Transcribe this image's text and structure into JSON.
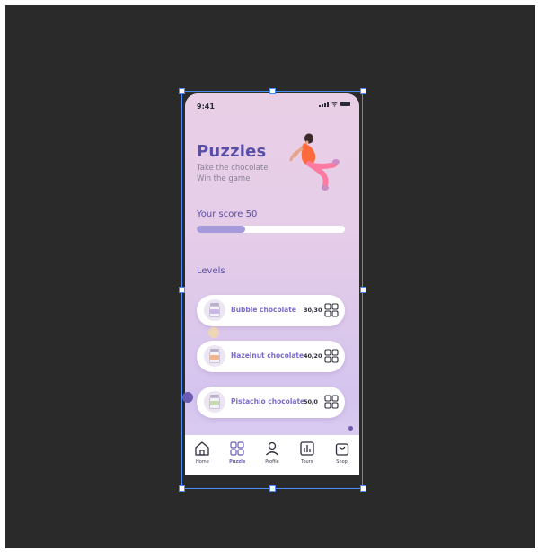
{
  "status_bar": {
    "time": "9:41"
  },
  "header": {
    "title": "Puzzles",
    "subtitle_line1": "Take the chocolate",
    "subtitle_line2": "Win the game"
  },
  "score": {
    "label": "Your score 50",
    "progress": 0.33
  },
  "levels": {
    "heading": "Levels",
    "items": [
      {
        "name": "Bubble chocolate",
        "score": "30/30",
        "jar_color": "#c9b8e8"
      },
      {
        "name": "Hazelnut chocolate",
        "score": "40/20",
        "jar_color": "#f2b48c"
      },
      {
        "name": "Pistachio chocolate",
        "score": "50/0",
        "jar_color": "#c7d9b0"
      }
    ]
  },
  "nav": {
    "items": [
      {
        "label": "Home",
        "icon": "home-icon",
        "active": false
      },
      {
        "label": "Puzzle",
        "icon": "puzzle-icon",
        "active": true
      },
      {
        "label": "Profile",
        "icon": "profile-icon",
        "active": false
      },
      {
        "label": "Tours",
        "icon": "chart-icon",
        "active": false
      },
      {
        "label": "Shop",
        "icon": "bag-icon",
        "active": false
      }
    ]
  },
  "colors": {
    "accent": "#5a4fa8",
    "accent_light": "#a59bdc",
    "canvas": "#2a2a2a",
    "selection": "#4a8cf7"
  }
}
